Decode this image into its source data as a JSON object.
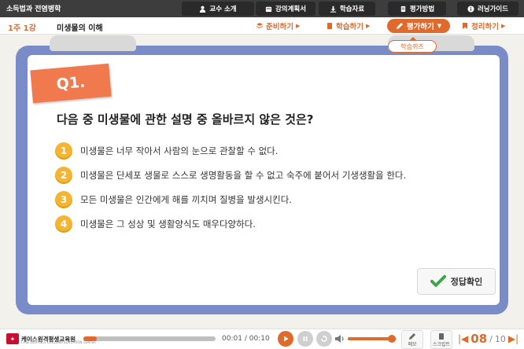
{
  "app": {
    "course_title": "소득법과 전염병학"
  },
  "topnav": {
    "items": [
      {
        "label": "교수 소개",
        "icon": "user-icon"
      },
      {
        "label": "강의계획서",
        "icon": "calendar-icon"
      },
      {
        "label": "학습자료",
        "icon": "download-icon"
      },
      {
        "label": "평가방법",
        "icon": "document-icon"
      },
      {
        "label": "러닝가이드",
        "icon": "info-icon"
      }
    ]
  },
  "subnav": {
    "week_label": "1주 1강",
    "lesson_title": "미생물의 이해",
    "steps": [
      {
        "label": "준비하기",
        "icon": "layers-icon"
      },
      {
        "label": "학습하기",
        "icon": "book-icon"
      },
      {
        "label": "평가하기",
        "icon": "pencil-icon",
        "active": true
      },
      {
        "label": "정리하기",
        "icon": "bookmark-icon"
      }
    ],
    "submenu_label": "학습퀴즈"
  },
  "quiz": {
    "number_label": "Q1.",
    "question": "다음 중 미생물에 관한 설명 중 올바르지 않은 것은?",
    "options": [
      {
        "num": "1",
        "text": "미생물은 너무 작아서 사람의 눈으로 관찰할 수 없다."
      },
      {
        "num": "2",
        "text": "미생물은 단세포 생물로 스스로 생명활동을 할 수 없고 숙주에 붙어서 기생생활을 한다."
      },
      {
        "num": "3",
        "text": "모든 미생물은 인간에게 해를 끼치며 질병을 발생시킨다."
      },
      {
        "num": "4",
        "text": "미생물은 그 성상 및 생활양식도 매우다양하다."
      }
    ],
    "check_label": "정답확인"
  },
  "player": {
    "logo_text": "케이스원격평생교육원",
    "logo_sub": "CASE DISTANCE LIFELONG EDUCATION CENTER",
    "time_current": "00:01",
    "time_total": "00:10",
    "time_sep": "/",
    "progress": 0.1,
    "volume": 0.9,
    "memo_label": "메모",
    "script_label": "스크립트",
    "page_current": "08",
    "page_sep": "/",
    "page_total": "10"
  },
  "colors": {
    "accent": "#e06a2c",
    "board": "#7a8cc8",
    "qtag": "#f07a4e",
    "option_num": "#f5b533",
    "topbar": "#3d3d3d"
  }
}
